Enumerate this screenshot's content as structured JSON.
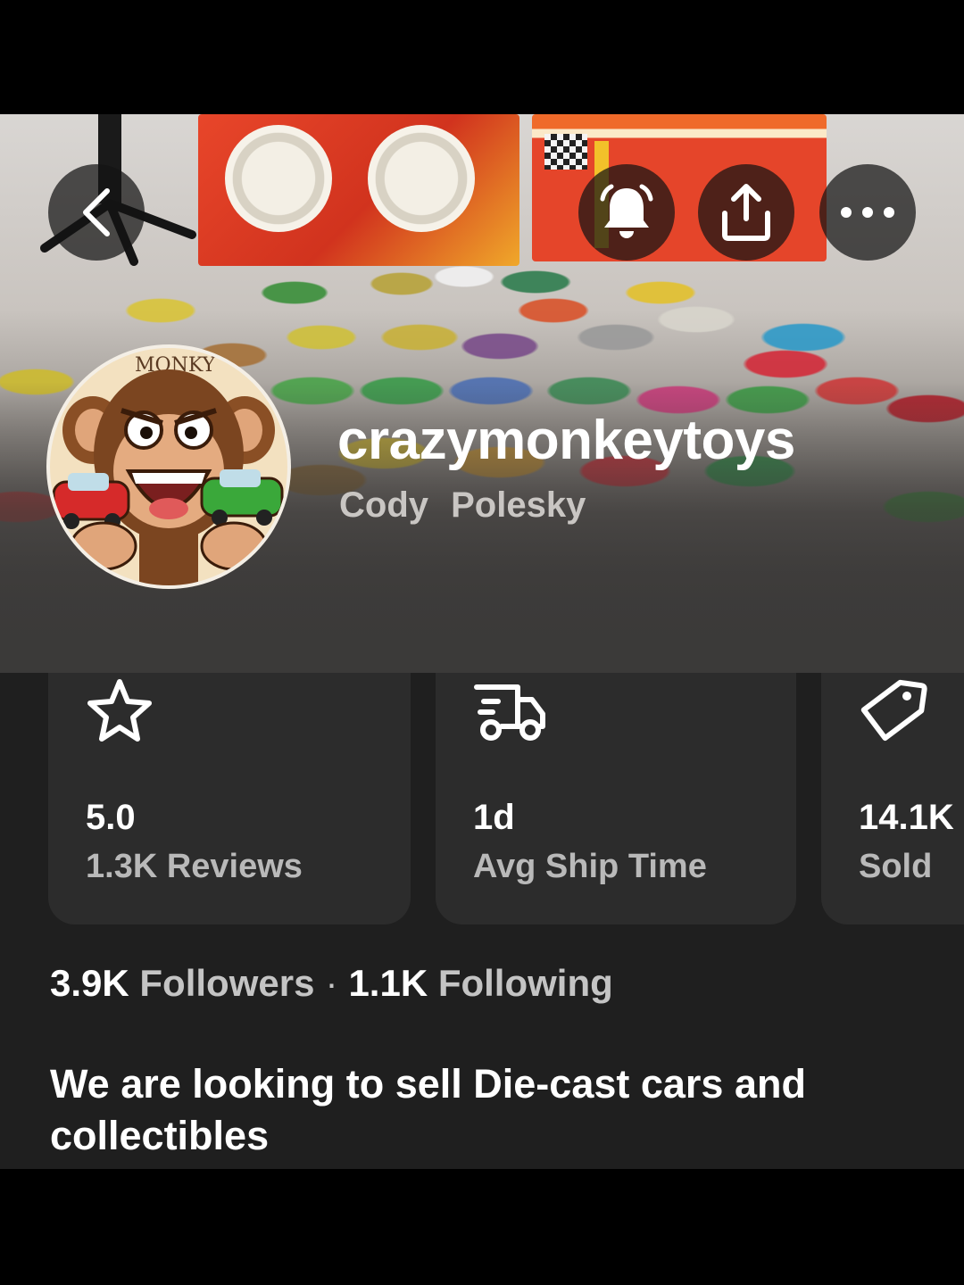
{
  "profile": {
    "username": "crazymonkeytoys",
    "real_name": "Cody  Polesky",
    "avatar_text": "MONKY"
  },
  "header": {
    "back_icon": "chevron-left-icon",
    "notify_icon": "bell-icon",
    "share_icon": "share-icon",
    "more_icon": "ellipsis-icon"
  },
  "stats": [
    {
      "icon": "star-icon",
      "value": "5.0",
      "label": "1.3K Reviews"
    },
    {
      "icon": "truck-icon",
      "value": "1d",
      "label": "Avg Ship Time"
    },
    {
      "icon": "tag-icon",
      "value": "14.1K",
      "label": "Sold"
    }
  ],
  "social": {
    "followers_count": "3.9K",
    "followers_label": "Followers",
    "separator": "·",
    "following_count": "1.1K",
    "following_label": "Following"
  },
  "bio": "We are looking to sell Die-cast cars and collectibles"
}
